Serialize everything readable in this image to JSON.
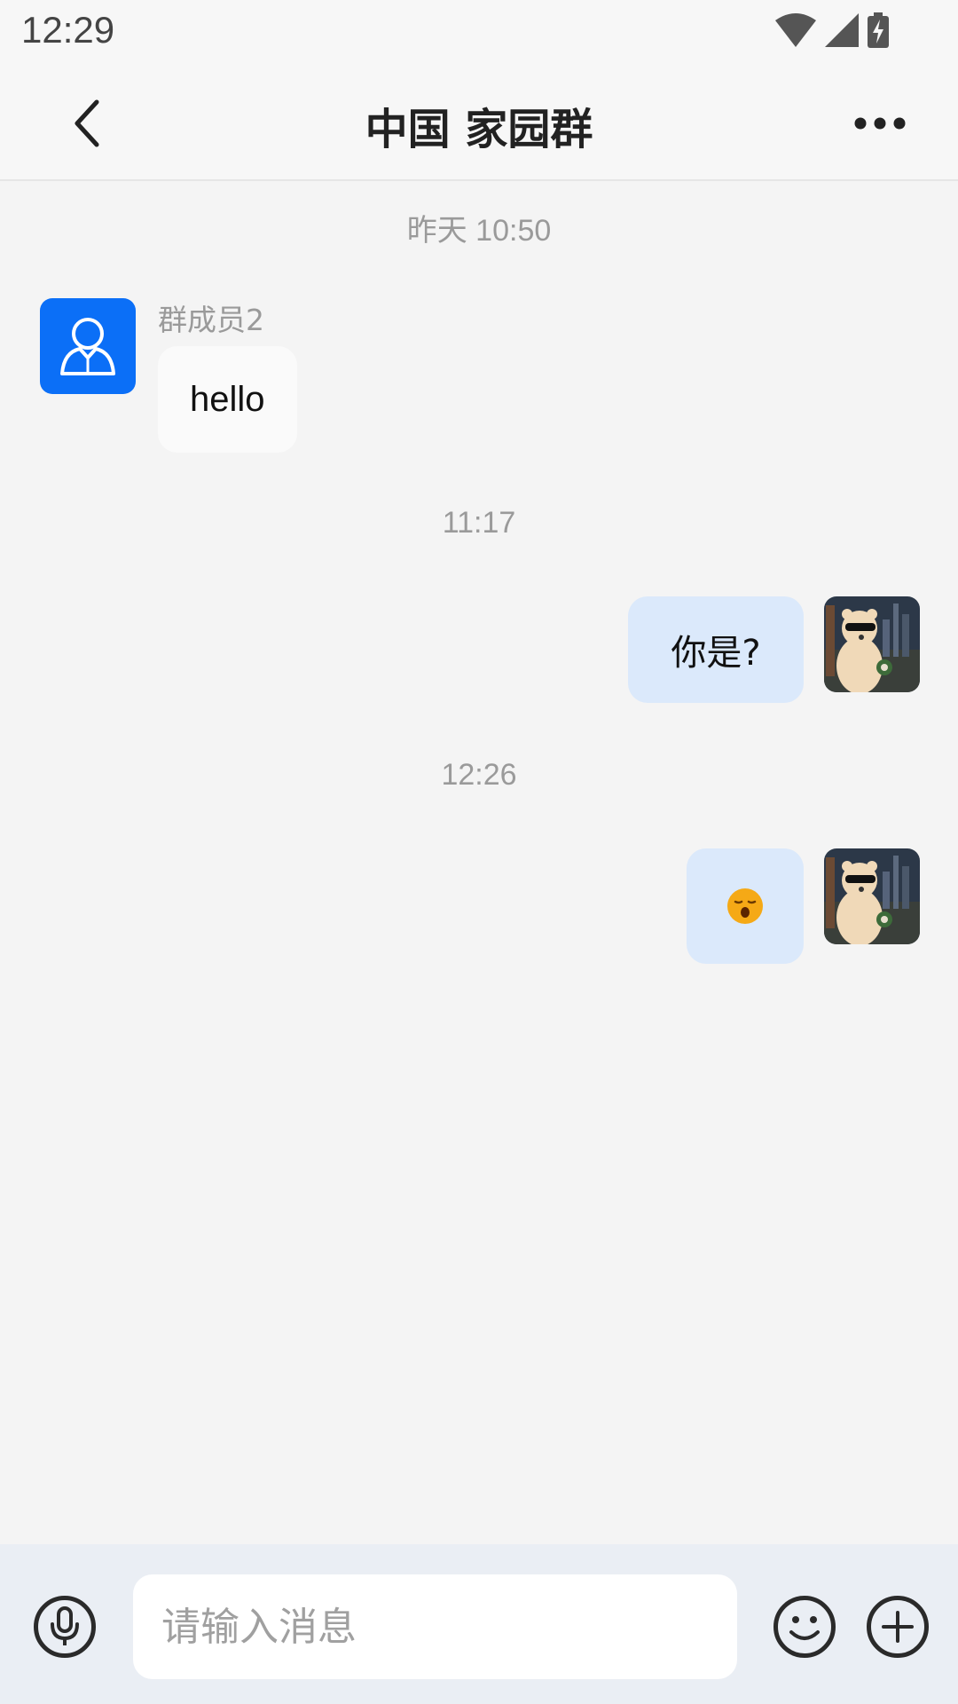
{
  "status_bar": {
    "time": "12:29",
    "icons": [
      "wifi-icon",
      "signal-icon",
      "battery-charging-icon"
    ]
  },
  "header": {
    "title": "中国 家园群",
    "back_icon": "chevron-left-icon",
    "more_icon": "more-horizontal-icon"
  },
  "messages": [
    {
      "type": "timestamp",
      "text": "昨天 10:50"
    },
    {
      "type": "incoming",
      "sender": "群成员2",
      "text": "hello",
      "avatar": "person-icon"
    },
    {
      "type": "timestamp",
      "text": "11:17"
    },
    {
      "type": "outgoing",
      "text": "你是?"
    },
    {
      "type": "timestamp",
      "text": "12:26"
    },
    {
      "type": "outgoing",
      "text": "",
      "emoji": "yawning-face-emoji"
    }
  ],
  "input_bar": {
    "placeholder": "请输入消息",
    "voice_icon": "microphone-icon",
    "emoji_icon": "smiley-icon",
    "plus_icon": "plus-circle-icon"
  },
  "colors": {
    "accent": "#0b6ff7",
    "outgoing_bubble": "#dbe9fb",
    "incoming_bubble": "#fafafa",
    "background": "#f4f4f4"
  }
}
